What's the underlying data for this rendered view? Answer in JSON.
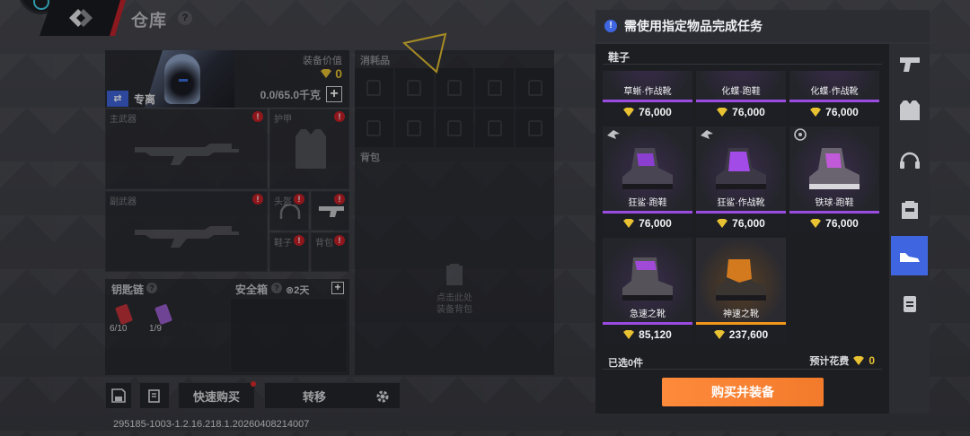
{
  "header": {
    "title": "仓库",
    "help": "?"
  },
  "character": {
    "tag": "专离",
    "value_label": "装备价值",
    "value": "0",
    "weight": "0.0/65.0千克"
  },
  "slots": [
    {
      "label": "主武器"
    },
    {
      "label": "护甲"
    },
    {
      "label": "副武器"
    },
    {
      "label": "头盔"
    },
    {
      "label": "鞋子"
    },
    {
      "label": "背包"
    }
  ],
  "keychain": {
    "label": "钥匙链",
    "help": "?",
    "counts": [
      "6/10",
      "1/9"
    ]
  },
  "safe_box": {
    "label": "安全箱",
    "help": "?",
    "duration": "⊗2天"
  },
  "consumables": {
    "label": "消耗品"
  },
  "backpack": {
    "label": "背包",
    "hint_line1": "点击此处",
    "hint_line2": "装备背包"
  },
  "bottom": {
    "quick_buy": "快速购买",
    "transfer": "转移",
    "build": "295185-1003-1.2.16.218.1.20260408214007"
  },
  "modal": {
    "title": "需使用指定物品完成任务",
    "category": "鞋子",
    "row0": [
      {
        "name": "草蜥·作战靴",
        "price": "76,000"
      },
      {
        "name": "化蝶·跑鞋",
        "price": "76,000"
      },
      {
        "name": "化蝶·作战靴",
        "price": "76,000"
      }
    ],
    "row1": [
      {
        "name": "狂鲨·跑鞋",
        "price": "76,000"
      },
      {
        "name": "狂鲨·作战靴",
        "price": "76,000"
      },
      {
        "name": "铁球·跑鞋",
        "price": "76,000"
      }
    ],
    "row2": [
      {
        "name": "急速之靴",
        "price": "85,120"
      },
      {
        "name": "神速之靴",
        "price": "237,600"
      }
    ],
    "selected": "已选0件",
    "cost_label": "预计花费",
    "cost_value": "0",
    "buy_button": "购买并装备"
  },
  "rail": [
    "pistol-icon",
    "armor-icon",
    "headset-icon",
    "backpack-icon",
    "shoe-icon",
    "container-icon"
  ],
  "colors": {
    "gold": "#e8c232",
    "rare_purple": "#9a4be0",
    "legend_orange": "#f0961a",
    "accent_blue": "#3f66e0",
    "buy_orange": "#f27a2b"
  }
}
